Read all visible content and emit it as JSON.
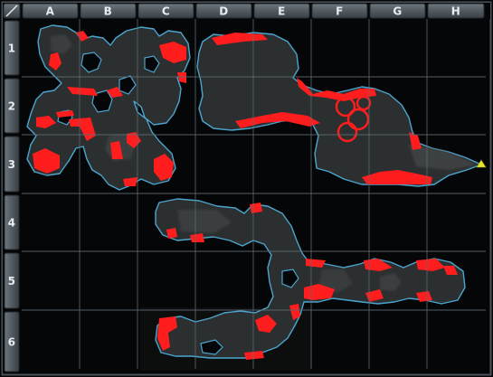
{
  "map": {
    "columns": [
      "A",
      "B",
      "C",
      "D",
      "E",
      "F",
      "G",
      "H"
    ],
    "rows": [
      "1",
      "2",
      "3",
      "4",
      "5",
      "6"
    ]
  },
  "colors": {
    "background": "#050607",
    "header": "#4a5259",
    "grid_line": "#5c6a73",
    "terrain": "#2c2f30",
    "terrain_light": "#4a4d4e",
    "coast": "#4ba6cf",
    "hazard": "#ff1d1d",
    "marker": "#e5e52a"
  },
  "icons": {
    "corner": "diagonal-slash-icon",
    "marker": "triangle-marker-icon"
  }
}
